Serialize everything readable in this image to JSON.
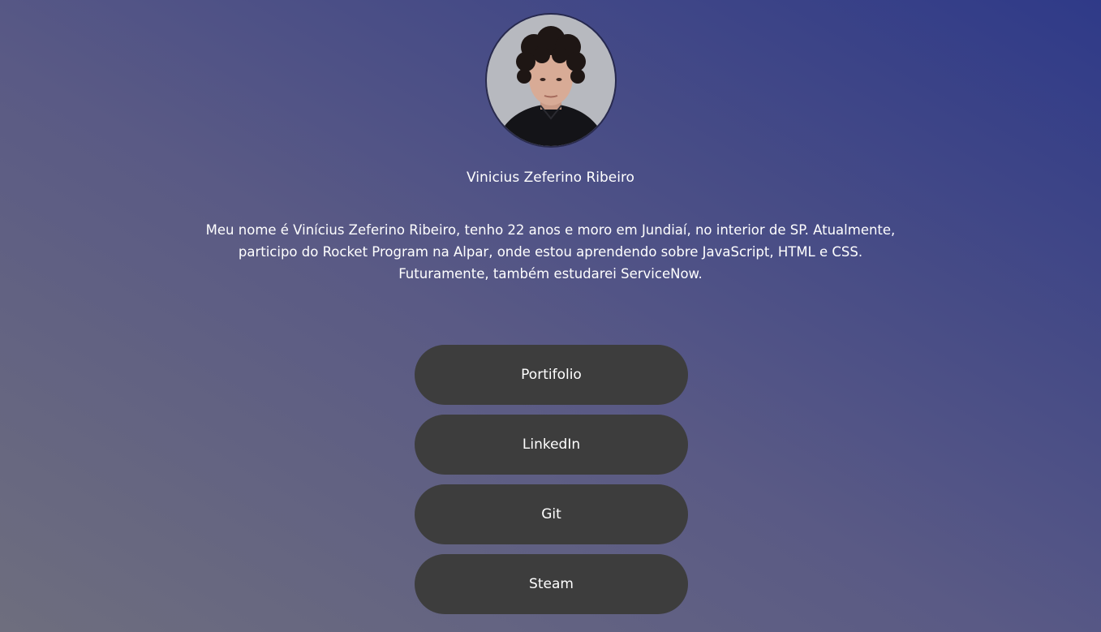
{
  "profile": {
    "name": "Vinicius Zeferino Ribeiro",
    "bio_lines": [
      "Meu nome é Vinícius Zeferino Ribeiro, tenho 22 anos e moro em Jundiaí, no interior de SP. Atualmente,",
      "participo do Rocket Program na Alpar, onde estou aprendendo sobre JavaScript, HTML e CSS.",
      "Futuramente, também estudarei ServiceNow."
    ]
  },
  "links": [
    {
      "label": "Portifolio"
    },
    {
      "label": "LinkedIn"
    },
    {
      "label": "Git"
    },
    {
      "label": "Steam"
    }
  ],
  "colors": {
    "button_bg": "#3d3d3d",
    "text": "#ffffff",
    "gradient_start": "#6e6e7e",
    "gradient_end": "#2f3a88"
  }
}
